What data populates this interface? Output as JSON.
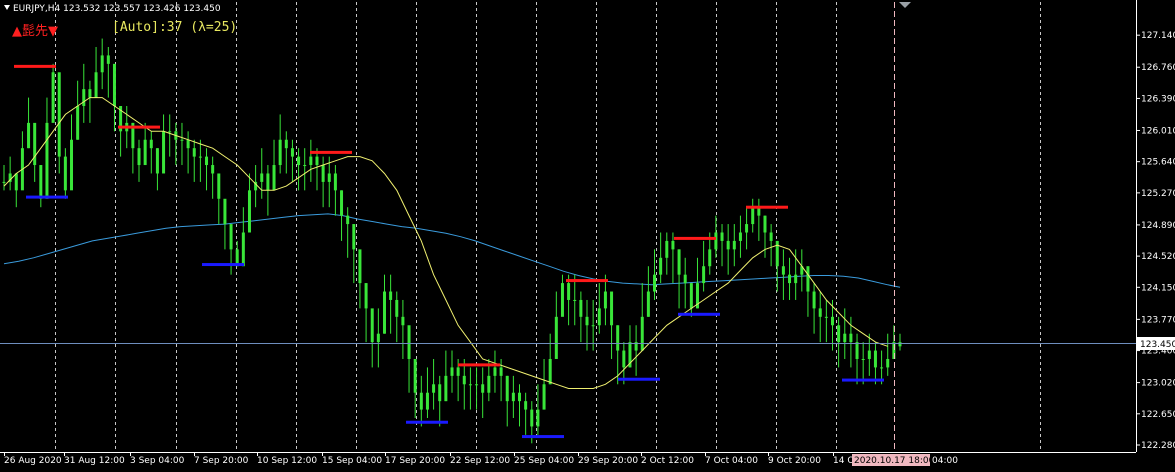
{
  "window": {
    "symbol_menu_icon": "triangle-down-icon",
    "header_text": "EURJPY,H4  123.532 123.557 123.426 123.450"
  },
  "indicator": {
    "signal_label": "▲髭先▼",
    "auto_label": "[Auto]:37 (λ=25)"
  },
  "colors": {
    "background": "#000000",
    "grid": "#c8c8c8",
    "candles": "#39e639",
    "ma_fast": "#f0f070",
    "ma_slow": "#3a9bdc",
    "price_line": "#6e8ebe",
    "high_marker": "#ff1a1a",
    "low_marker": "#1a1aff",
    "axis_text": "#ffffff",
    "time_badge": "#f0b8c0"
  },
  "chart_data": {
    "type": "line",
    "ylim": [
      122.28,
      127.32
    ],
    "y_ticks": [
      "127.140",
      "126.760",
      "126.390",
      "126.010",
      "125.640",
      "125.270",
      "124.890",
      "124.520",
      "124.150",
      "123.770",
      "123.400",
      "123.020",
      "122.650",
      "122.280"
    ],
    "x_ticks": [
      "26 Aug 2020",
      "31 Aug 12:00",
      "3 Sep 04:00",
      "7 Sep 20:00",
      "10 Sep 12:00",
      "15 Sep 04:00",
      "17 Sep 20:00",
      "22 Sep 12:00",
      "25 Sep 04:00",
      "29 Sep 20:00",
      "2 Oct 12:00",
      "7 Oct 04:00",
      "9 Oct 20:00",
      "14 Oct 12:00"
    ],
    "x_end_label": "04:00",
    "current_price": "123.450",
    "cursor_time": "2020.10.17 18:00",
    "series": [
      {
        "key": "close",
        "values": [
          125.4,
          125.5,
          125.3,
          125.8,
          126.1,
          125.6,
          125.2,
          126.1,
          126.7,
          125.7,
          125.3,
          125.9,
          126.3,
          126.5,
          126.4,
          126.7,
          126.9,
          126.8,
          126.3,
          126.0,
          126.1,
          125.8,
          125.6,
          125.9,
          125.8,
          125.5,
          126.0,
          126.0,
          125.9,
          125.9,
          125.8,
          125.7,
          125.7,
          125.6,
          125.5,
          125.2,
          124.9,
          124.6,
          124.4,
          124.8,
          125.3,
          125.4,
          125.5,
          125.3,
          125.6,
          125.9,
          125.8,
          125.7,
          125.6,
          125.6,
          125.7,
          125.6,
          125.4,
          125.5,
          125.3,
          125.0,
          124.9,
          124.6,
          124.2,
          123.9,
          123.5,
          123.6,
          124.1,
          124.0,
          123.8,
          123.7,
          123.3,
          122.9,
          122.7,
          122.9,
          123.0,
          122.8,
          123.1,
          123.2,
          123.1,
          123.0,
          123.0,
          123.0,
          122.9,
          123.1,
          123.2,
          123.1,
          122.8,
          122.9,
          122.8,
          122.7,
          122.5,
          122.7,
          123.0,
          123.3,
          123.8,
          124.2,
          124.0,
          124.0,
          123.8,
          123.7,
          123.7,
          123.9,
          124.1,
          123.7,
          123.4,
          123.2,
          123.5,
          123.4,
          123.8,
          124.1,
          124.3,
          124.5,
          124.7,
          124.6,
          124.3,
          124.2,
          123.9,
          124.2,
          124.4,
          124.6,
          124.8,
          124.7,
          124.6,
          124.7,
          124.8,
          124.9,
          125.1,
          125.0,
          124.8,
          124.7,
          124.4,
          124.3,
          124.2,
          124.3,
          124.4,
          124.1,
          123.9,
          123.8,
          123.8,
          123.7,
          123.5,
          123.6,
          123.5,
          123.3,
          123.3,
          123.4,
          123.2,
          123.2,
          123.3,
          123.5,
          123.45
        ],
        "ranges": [
          [
            125.3,
            125.6
          ],
          [
            125.3,
            125.7
          ],
          [
            125.1,
            125.5
          ],
          [
            125.4,
            126.0
          ],
          [
            125.8,
            126.4
          ],
          [
            125.4,
            126.0
          ],
          [
            125.1,
            125.6
          ],
          [
            125.6,
            126.4
          ],
          [
            126.2,
            126.8
          ],
          [
            125.5,
            126.6
          ],
          [
            125.2,
            125.8
          ],
          [
            125.5,
            126.2
          ],
          [
            125.9,
            126.6
          ],
          [
            126.1,
            126.8
          ],
          [
            126.1,
            126.6
          ],
          [
            126.4,
            127.0
          ],
          [
            126.5,
            127.1
          ],
          [
            126.4,
            127.0
          ],
          [
            126.0,
            126.6
          ],
          [
            125.7,
            126.2
          ],
          [
            125.8,
            126.3
          ],
          [
            125.5,
            126.1
          ],
          [
            125.4,
            125.9
          ],
          [
            125.6,
            126.1
          ],
          [
            125.5,
            126.0
          ],
          [
            125.3,
            125.8
          ],
          [
            125.6,
            126.2
          ],
          [
            125.7,
            126.2
          ],
          [
            125.6,
            126.1
          ],
          [
            125.6,
            126.1
          ],
          [
            125.5,
            126.0
          ],
          [
            125.4,
            125.9
          ],
          [
            125.4,
            125.9
          ],
          [
            125.3,
            125.8
          ],
          [
            125.2,
            125.7
          ],
          [
            124.9,
            125.4
          ],
          [
            124.6,
            125.1
          ],
          [
            124.3,
            124.8
          ],
          [
            124.4,
            124.7
          ],
          [
            124.5,
            125.1
          ],
          [
            124.9,
            125.5
          ],
          [
            125.1,
            125.6
          ],
          [
            125.2,
            125.8
          ],
          [
            125.0,
            125.6
          ],
          [
            125.3,
            125.9
          ],
          [
            125.5,
            126.2
          ],
          [
            125.5,
            126.0
          ],
          [
            125.4,
            125.9
          ],
          [
            125.3,
            125.8
          ],
          [
            125.3,
            125.8
          ],
          [
            125.4,
            125.9
          ],
          [
            125.3,
            125.8
          ],
          [
            125.1,
            125.7
          ],
          [
            125.1,
            125.7
          ],
          [
            125.0,
            125.6
          ],
          [
            124.7,
            125.3
          ],
          [
            124.5,
            125.1
          ],
          [
            124.2,
            124.9
          ],
          [
            123.9,
            124.5
          ],
          [
            123.5,
            124.2
          ],
          [
            123.2,
            123.8
          ],
          [
            123.2,
            123.9
          ],
          [
            123.6,
            124.3
          ],
          [
            123.6,
            124.3
          ],
          [
            123.5,
            124.1
          ],
          [
            123.3,
            124.0
          ],
          [
            122.9,
            123.6
          ],
          [
            122.6,
            123.2
          ],
          [
            122.5,
            123.1
          ],
          [
            122.6,
            123.2
          ],
          [
            122.7,
            123.3
          ],
          [
            122.5,
            123.1
          ],
          [
            122.8,
            123.4
          ],
          [
            122.9,
            123.4
          ],
          [
            122.8,
            123.3
          ],
          [
            122.7,
            123.3
          ],
          [
            122.7,
            123.2
          ],
          [
            122.7,
            123.2
          ],
          [
            122.6,
            123.2
          ],
          [
            122.8,
            123.3
          ],
          [
            122.9,
            123.4
          ],
          [
            122.8,
            123.3
          ],
          [
            122.5,
            123.1
          ],
          [
            122.6,
            123.1
          ],
          [
            122.5,
            123.0
          ],
          [
            122.4,
            122.9
          ],
          [
            122.3,
            122.8
          ],
          [
            122.4,
            123.0
          ],
          [
            122.7,
            123.3
          ],
          [
            123.0,
            123.6
          ],
          [
            123.4,
            124.1
          ],
          [
            123.9,
            124.3
          ],
          [
            123.7,
            124.3
          ],
          [
            123.7,
            124.3
          ],
          [
            123.5,
            124.1
          ],
          [
            123.4,
            124.0
          ],
          [
            123.4,
            124.0
          ],
          [
            123.6,
            124.2
          ],
          [
            123.7,
            124.3
          ],
          [
            123.3,
            124.0
          ],
          [
            123.0,
            123.7
          ],
          [
            123.0,
            123.5
          ],
          [
            123.2,
            123.7
          ],
          [
            123.1,
            123.7
          ],
          [
            123.5,
            124.2
          ],
          [
            123.8,
            124.4
          ],
          [
            124.0,
            124.6
          ],
          [
            124.2,
            124.8
          ],
          [
            124.3,
            124.8
          ],
          [
            124.2,
            124.8
          ],
          [
            123.9,
            124.6
          ],
          [
            123.9,
            124.5
          ],
          [
            123.8,
            124.2
          ],
          [
            123.9,
            124.5
          ],
          [
            124.1,
            124.7
          ],
          [
            124.3,
            124.8
          ],
          [
            124.5,
            125.0
          ],
          [
            124.4,
            124.9
          ],
          [
            124.3,
            124.9
          ],
          [
            124.4,
            124.9
          ],
          [
            124.5,
            125.0
          ],
          [
            124.6,
            125.1
          ],
          [
            124.8,
            125.2
          ],
          [
            124.7,
            125.2
          ],
          [
            124.5,
            125.0
          ],
          [
            124.4,
            124.9
          ],
          [
            124.1,
            124.7
          ],
          [
            124.0,
            124.6
          ],
          [
            124.0,
            124.5
          ],
          [
            124.0,
            124.6
          ],
          [
            124.1,
            124.6
          ],
          [
            123.8,
            124.4
          ],
          [
            123.6,
            124.2
          ],
          [
            123.5,
            124.1
          ],
          [
            123.5,
            124.0
          ],
          [
            123.4,
            124.0
          ],
          [
            123.2,
            123.8
          ],
          [
            123.3,
            123.9
          ],
          [
            123.2,
            123.8
          ],
          [
            123.0,
            123.6
          ],
          [
            123.0,
            123.5
          ],
          [
            123.1,
            123.6
          ],
          [
            123.0,
            123.5
          ],
          [
            123.0,
            123.4
          ],
          [
            123.1,
            123.6
          ],
          [
            123.3,
            123.7
          ],
          [
            123.4,
            123.6
          ]
        ]
      },
      {
        "key": "ma_fast",
        "values": [
          125.35,
          125.5,
          125.6,
          125.8,
          126.0,
          126.2,
          126.3,
          126.4,
          126.4,
          126.3,
          126.2,
          126.1,
          126.0,
          126.0,
          125.95,
          125.9,
          125.85,
          125.8,
          125.7,
          125.6,
          125.45,
          125.3,
          125.3,
          125.35,
          125.45,
          125.55,
          125.6,
          125.65,
          125.7,
          125.7,
          125.65,
          125.5,
          125.3,
          125.0,
          124.7,
          124.3,
          124.0,
          123.7,
          123.5,
          123.3,
          123.25,
          123.2,
          123.15,
          123.1,
          123.05,
          123.0,
          122.95,
          122.95,
          122.95,
          123.0,
          123.1,
          123.25,
          123.4,
          123.55,
          123.7,
          123.8,
          123.9,
          124.0,
          124.1,
          124.2,
          124.35,
          124.5,
          124.6,
          124.65,
          124.6,
          124.4,
          124.2,
          124.0,
          123.85,
          123.7,
          123.6,
          123.5,
          123.45
        ],
        "x_from": 0,
        "x_step": 2
      },
      {
        "key": "ma_slow",
        "values": [
          124.43,
          124.46,
          124.5,
          124.55,
          124.6,
          124.65,
          124.7,
          124.73,
          124.76,
          124.79,
          124.82,
          124.85,
          124.87,
          124.88,
          124.89,
          124.9,
          124.92,
          124.94,
          124.96,
          124.98,
          125.0,
          125.01,
          125.02,
          125.0,
          124.96,
          124.93,
          124.9,
          124.87,
          124.85,
          124.82,
          124.79,
          124.75,
          124.7,
          124.64,
          124.58,
          124.52,
          124.46,
          124.4,
          124.34,
          124.29,
          124.25,
          124.22,
          124.2,
          124.19,
          124.18,
          124.19,
          124.2,
          124.21,
          124.22,
          124.23,
          124.24,
          124.25,
          124.26,
          124.27,
          124.28,
          124.29,
          124.29,
          124.28,
          124.26,
          124.22,
          124.18,
          124.15
        ],
        "x_from": 0,
        "x_step": 2.4
      }
    ],
    "swing_highs": [
      126.77,
      126.05,
      125.75,
      123.23,
      124.23,
      124.73,
      125.1
    ],
    "swing_lows": [
      125.22,
      124.42,
      122.55,
      122.38,
      123.06,
      123.83,
      123.05
    ]
  }
}
